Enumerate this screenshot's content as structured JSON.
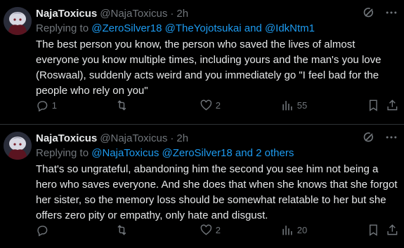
{
  "tweets": [
    {
      "name": "NajaToxicus",
      "handle": "@NajaToxicus",
      "dot": "·",
      "time": "2h",
      "replying_prefix": "Replying to",
      "replying_to": [
        "@ZeroSilver18",
        "@TheYojotsukai",
        "@IdkNtm1"
      ],
      "replying_joiners": [
        " ",
        " and "
      ],
      "replying_suffix": "",
      "text": "The best person you know, the person who saved the lives of almost everyone you know multiple times, including yours and the man's you love (Roswaal), suddenly acts weird and you immediately go \"I feel bad for the people who rely on you\"",
      "replies": "1",
      "retweets": "",
      "likes": "2",
      "views": "55"
    },
    {
      "name": "NajaToxicus",
      "handle": "@NajaToxicus",
      "dot": "·",
      "time": "2h",
      "replying_prefix": "Replying to",
      "replying_to": [
        "@NajaToxicus",
        "@ZeroSilver18",
        "and 2 others"
      ],
      "replying_joiners": [
        " ",
        " "
      ],
      "replying_suffix": "",
      "text": "That's so ungrateful, abandoning him the second you see him not being a hero who saves everyone. And she does that when she knows that she forgot her sister, so the memory loss should be somewhat relatable to her but she offers zero pity or empathy, only hate and disgust.",
      "replies": "",
      "retweets": "",
      "likes": "2",
      "views": "20"
    }
  ],
  "icons": {
    "reply": "reply-icon",
    "retweet": "retweet-icon",
    "like": "heart-icon",
    "views": "views-icon",
    "bookmark": "bookmark-icon",
    "share": "share-icon",
    "grok": "grok-icon",
    "more": "more-icon"
  },
  "colors": {
    "background": "#000000",
    "text": "#e7e9ea",
    "muted": "#71767b",
    "link": "#1d9bf0",
    "divider": "#2f3336"
  }
}
